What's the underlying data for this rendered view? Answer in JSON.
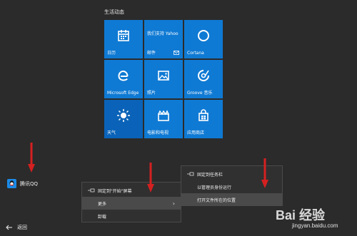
{
  "start_panel": {
    "title": "生活动态",
    "tiles": [
      {
        "label": "日历",
        "icon": "calendar-icon"
      },
      {
        "label": "我们支持 Yahoo",
        "sub": "邮件",
        "icon": "mail-icon"
      },
      {
        "label": "Cortana",
        "icon": "cortana-icon"
      },
      {
        "label": "Microsoft Edge",
        "icon": "edge-icon"
      },
      {
        "label": "照片",
        "icon": "photo-icon"
      },
      {
        "label": "Groove 音乐",
        "icon": "music-icon"
      },
      {
        "label": "天气",
        "icon": "sun-icon"
      },
      {
        "label": "电影和电视",
        "icon": "film-icon"
      },
      {
        "label": "应用商店",
        "icon": "store-icon"
      }
    ]
  },
  "apps": {
    "qq_label": "腾讯QQ"
  },
  "back": {
    "label": "返回"
  },
  "context_menu_main": {
    "items": [
      {
        "label": "固定到\"开始\"屏幕",
        "icon": "pin-icon"
      },
      {
        "label": "更多",
        "has_submenu": true
      },
      {
        "label": "卸载"
      }
    ]
  },
  "context_menu_sub": {
    "items": [
      {
        "label": "固定到任务栏",
        "icon": "pin-icon"
      },
      {
        "label": "以管理员身份运行"
      },
      {
        "label": "打开文件所在的位置"
      }
    ]
  },
  "watermark": {
    "main": "Bai 经验",
    "sub": "jingyan.baidu.com"
  },
  "colors": {
    "tile_blue": "#0f7ad4",
    "weather_blue": "#0a63b8",
    "bg": "#2b2b2b",
    "arrow_red": "#d42020"
  }
}
